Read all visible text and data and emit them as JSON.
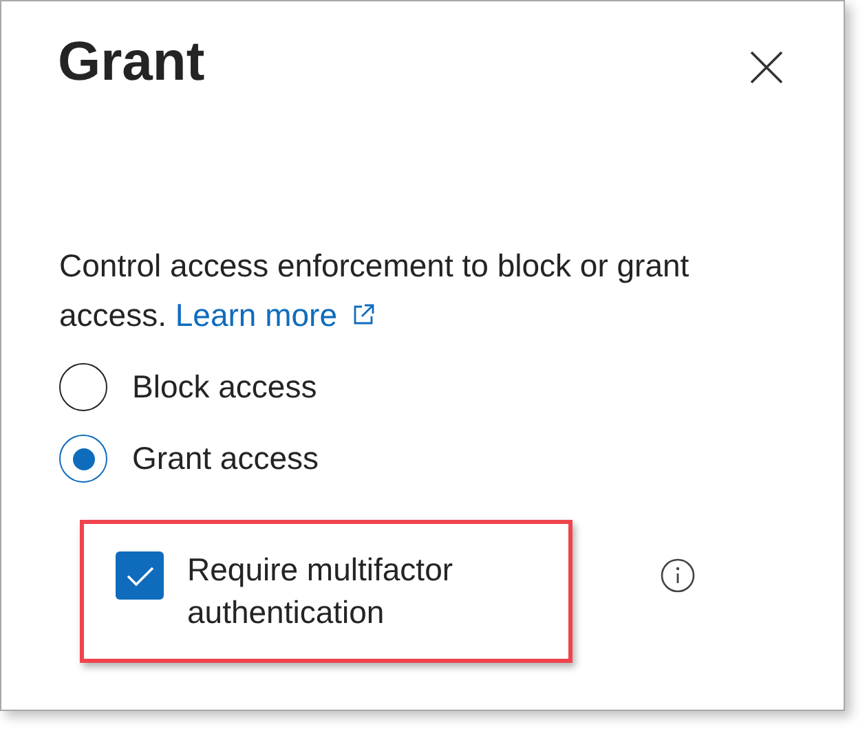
{
  "panel": {
    "title": "Grant"
  },
  "description": {
    "text": "Control access enforcement to block or grant access.",
    "link": "Learn more"
  },
  "access_options": [
    {
      "label": "Block access",
      "selected": false
    },
    {
      "label": "Grant access",
      "selected": true
    }
  ],
  "controls": [
    {
      "label": "Require multifactor authentication",
      "checked": true,
      "highlighted": true
    }
  ]
}
